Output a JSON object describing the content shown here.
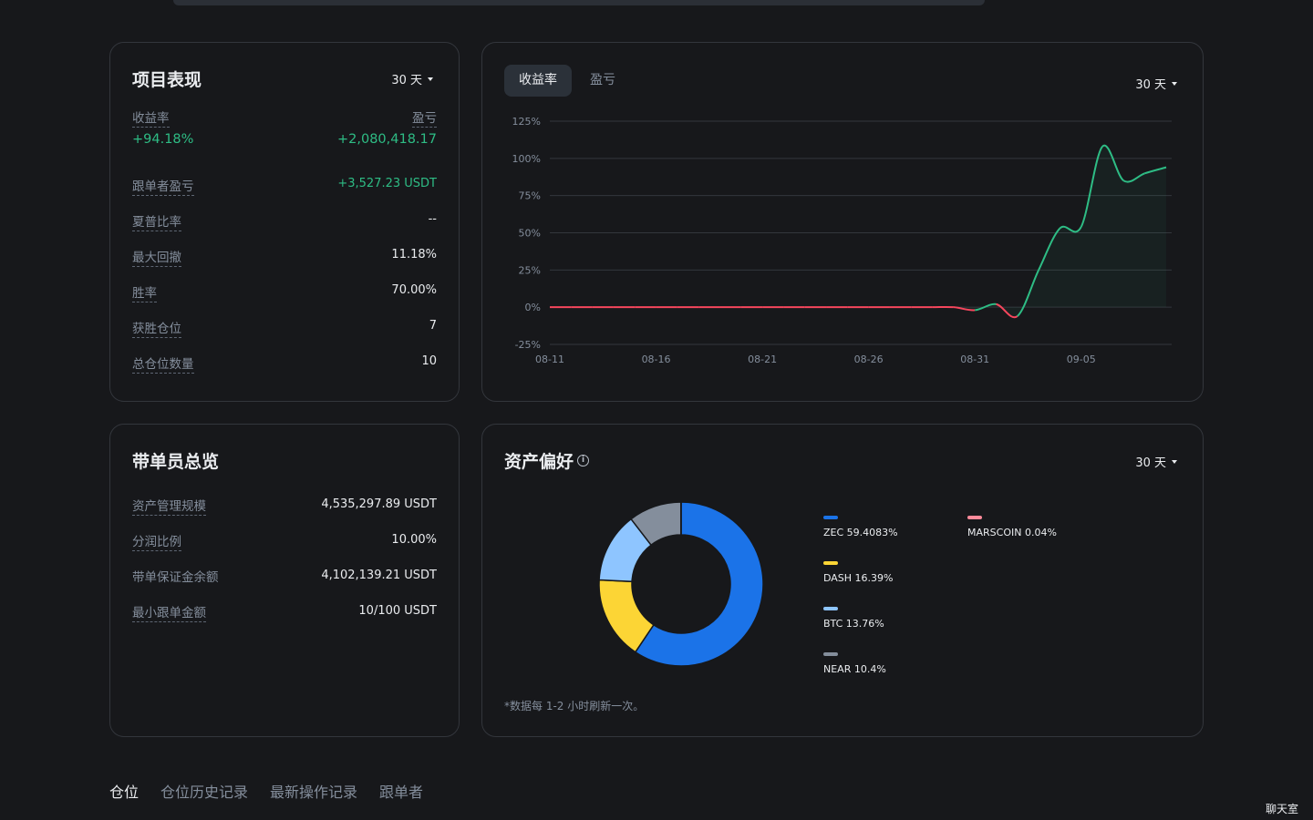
{
  "performance": {
    "title": "项目表现",
    "period": "30 天",
    "roi_label": "收益率",
    "pnl_label": "盈亏",
    "roi_value": "+94.18%",
    "pnl_value": "+2,080,418.17",
    "rows": [
      {
        "label": "跟单者盈亏",
        "value": "+3,527.23 USDT"
      },
      {
        "label": "夏普比率",
        "value": "--"
      },
      {
        "label": "最大回撤",
        "value": "11.18%"
      },
      {
        "label": "胜率",
        "value": "70.00%"
      },
      {
        "label": "获胜仓位",
        "value": "7"
      },
      {
        "label": "总仓位数量",
        "value": "10"
      }
    ]
  },
  "chart_panel": {
    "tabs": [
      "收益率",
      "盈亏"
    ],
    "active_tab": "收益率",
    "period": "30 天"
  },
  "chart_data": {
    "type": "line",
    "xlabel": "",
    "ylabel": "",
    "x_ticks": [
      "08-11",
      "08-16",
      "08-21",
      "08-26",
      "08-31",
      "09-05"
    ],
    "y_ticks": [
      "125%",
      "100%",
      "75%",
      "50%",
      "25%",
      "0%",
      "-25%"
    ],
    "ylim": [
      -25,
      125
    ],
    "series": [
      {
        "x": [
          "08-11",
          "08-12",
          "08-13",
          "08-14",
          "08-15",
          "08-16",
          "08-17",
          "08-18",
          "08-19",
          "08-20",
          "08-21",
          "08-22",
          "08-23",
          "08-24",
          "08-25",
          "08-26",
          "08-27",
          "08-28",
          "08-29",
          "08-30",
          "08-31",
          "09-01",
          "09-02",
          "09-03",
          "09-04",
          "09-05",
          "09-06",
          "09-07",
          "09-08",
          "09-09"
        ],
        "values": [
          0,
          0,
          0,
          0,
          0,
          0,
          0,
          0,
          0,
          0,
          0,
          0,
          0,
          0,
          0,
          0,
          0,
          0,
          0,
          0,
          -2,
          2,
          -6,
          25,
          53,
          54,
          108,
          85,
          90,
          94
        ],
        "color_positive": "#2ebd85",
        "color_negative": "#f6465d"
      }
    ]
  },
  "leader": {
    "title": "带单员总览",
    "rows": [
      {
        "label": "资产管理规模",
        "value": "4,535,297.89 USDT"
      },
      {
        "label": "分润比例",
        "value": "10.00%"
      },
      {
        "label": "带单保证金余额",
        "value": "4,102,139.21 USDT"
      },
      {
        "label": "最小跟单金额",
        "value": "10/100 USDT"
      }
    ]
  },
  "assets": {
    "title": "资产偏好",
    "period": "30 天",
    "footnote": "*数据每 1-2 小时刷新一次。",
    "chart_data": {
      "type": "pie",
      "slices": [
        {
          "label": "ZEC 59.4083%",
          "value": 59.4083,
          "color": "#1b73e8"
        },
        {
          "label": "DASH 16.39%",
          "value": 16.39,
          "color": "#fcd535"
        },
        {
          "label": "BTC 13.76%",
          "value": 13.76,
          "color": "#8ec5ff"
        },
        {
          "label": "NEAR 10.4%",
          "value": 10.4,
          "color": "#848e9c"
        },
        {
          "label": "MARSCOIN 0.04%",
          "value": 0.04,
          "color": "#ff8a9a"
        }
      ]
    }
  },
  "bottom_tabs": [
    "仓位",
    "仓位历史记录",
    "最新操作记录",
    "跟单者"
  ],
  "chatroom": "聊天室"
}
